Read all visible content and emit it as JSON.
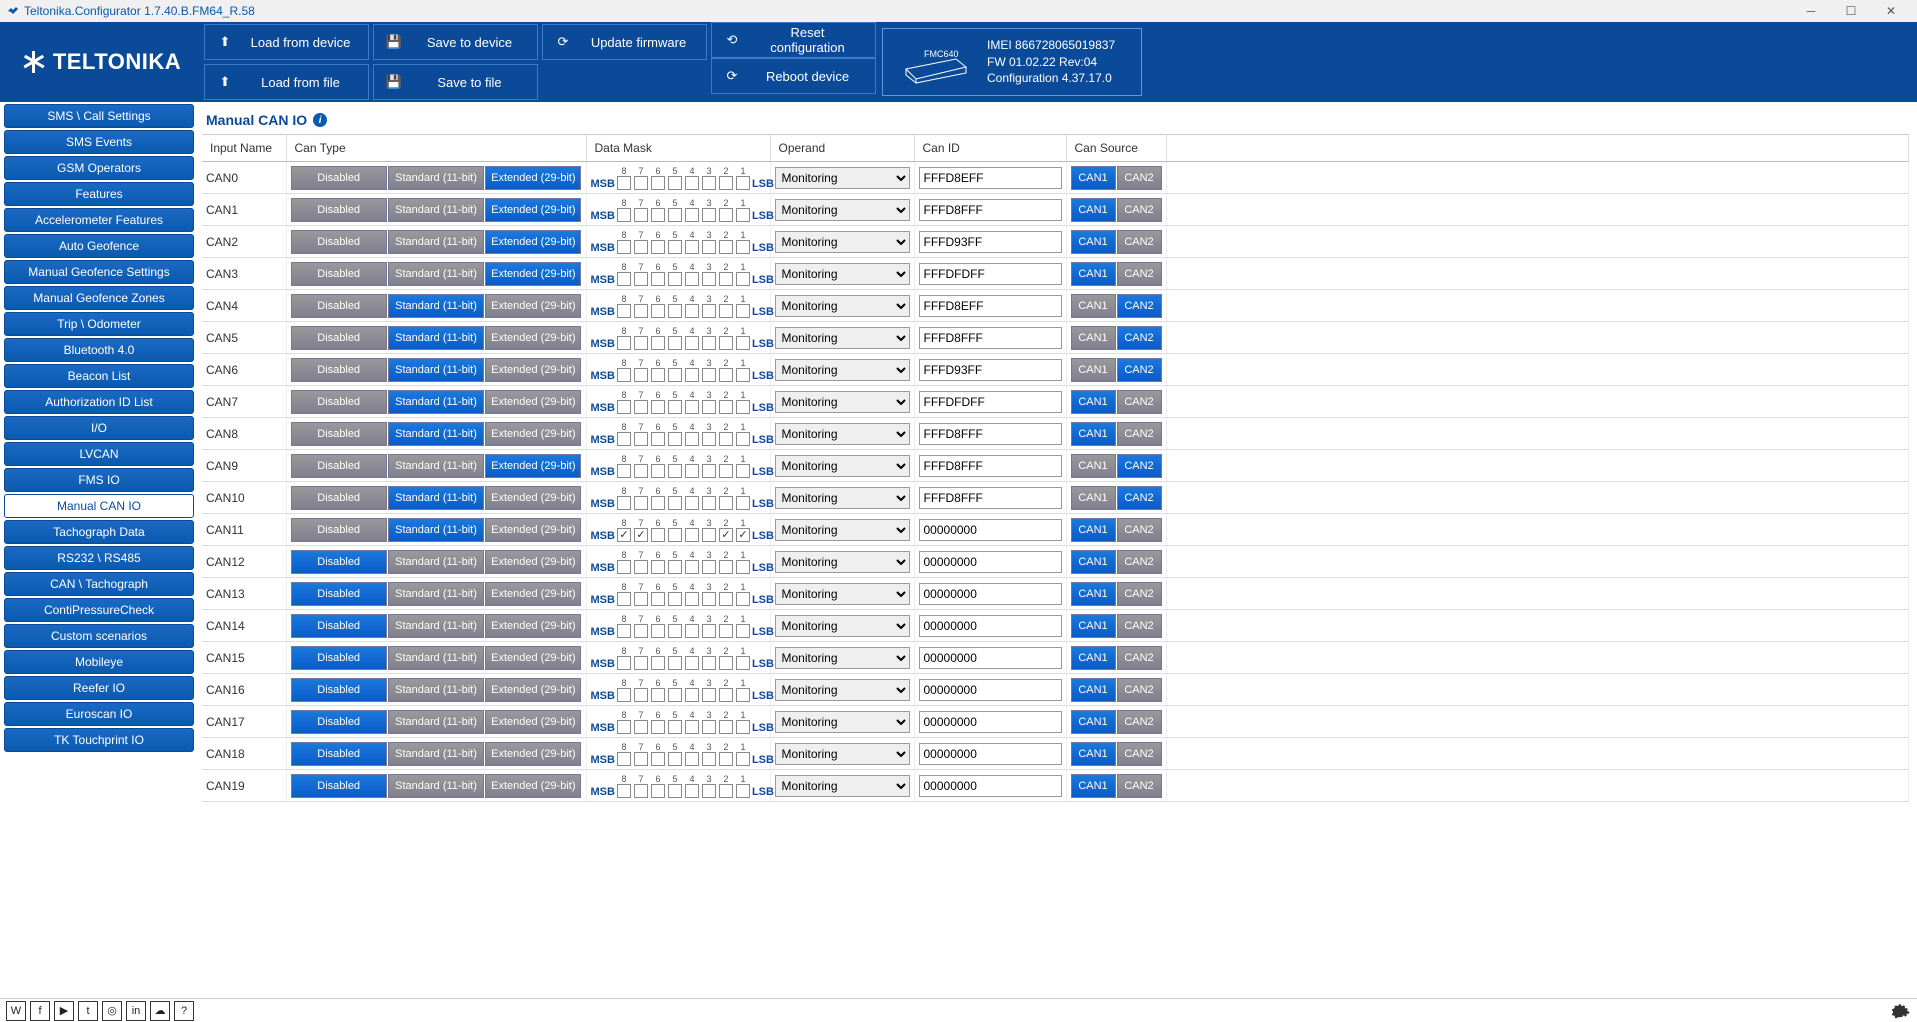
{
  "window": {
    "title": "Teltonika.Configurator 1.7.40.B.FM64_R.58"
  },
  "logo": "TELTONIKA",
  "toolbar": {
    "load_device": "Load from device",
    "save_device": "Save to device",
    "update_fw": "Update firmware",
    "reset_cfg": "Reset configuration",
    "load_file": "Load from file",
    "save_file": "Save to file",
    "reboot": "Reboot device"
  },
  "device": {
    "model": "FMC640",
    "imei_label": "IMEI",
    "imei": "866728065019837",
    "fw_label": "FW",
    "fw": "01.02.22 Rev:04",
    "cfg_label": "Configuration",
    "cfg": "4.37.17.0"
  },
  "sidebar": [
    "SMS \\ Call Settings",
    "SMS Events",
    "GSM Operators",
    "Features",
    "Accelerometer Features",
    "Auto Geofence",
    "Manual Geofence Settings",
    "Manual Geofence Zones",
    "Trip \\ Odometer",
    "Bluetooth 4.0",
    "Beacon List",
    "Authorization ID List",
    "I/O",
    "LVCAN",
    "FMS IO",
    "Manual CAN IO",
    "Tachograph Data",
    "RS232 \\ RS485",
    "CAN \\ Tachograph",
    "ContiPressureCheck",
    "Custom scenarios",
    "Mobileye",
    "Reefer IO",
    "Euroscan IO",
    "TK Touchprint IO"
  ],
  "sidebar_active": 15,
  "section_title": "Manual CAN IO",
  "columns": {
    "name": "Input Name",
    "type": "Can Type",
    "mask": "Data Mask",
    "operand": "Operand",
    "canid": "Can ID",
    "source": "Can Source"
  },
  "seg_labels": {
    "disabled": "Disabled",
    "std": "Standard (11-bit)",
    "ext": "Extended (29-bit)"
  },
  "mask_labels": {
    "msb": "MSB",
    "lsb": "LSB"
  },
  "src_labels": {
    "can1": "CAN1",
    "can2": "CAN2"
  },
  "operand_options": [
    "Monitoring"
  ],
  "bit_numbers": [
    "8",
    "7",
    "6",
    "5",
    "4",
    "3",
    "2",
    "1"
  ],
  "rows": [
    {
      "name": "CAN0",
      "type": "ext",
      "mask": [
        0,
        0,
        0,
        0,
        0,
        0,
        0,
        0
      ],
      "operand": "Monitoring",
      "canid": "FFFD8EFF",
      "src": "can1"
    },
    {
      "name": "CAN1",
      "type": "ext",
      "mask": [
        0,
        0,
        0,
        0,
        0,
        0,
        0,
        0
      ],
      "operand": "Monitoring",
      "canid": "FFFD8FFF",
      "src": "can1"
    },
    {
      "name": "CAN2",
      "type": "ext",
      "mask": [
        0,
        0,
        0,
        0,
        0,
        0,
        0,
        0
      ],
      "operand": "Monitoring",
      "canid": "FFFD93FF",
      "src": "can1"
    },
    {
      "name": "CAN3",
      "type": "ext",
      "mask": [
        0,
        0,
        0,
        0,
        0,
        0,
        0,
        0
      ],
      "operand": "Monitoring",
      "canid": "FFFDFDFF",
      "src": "can1"
    },
    {
      "name": "CAN4",
      "type": "std",
      "mask": [
        0,
        0,
        0,
        0,
        0,
        0,
        0,
        0
      ],
      "operand": "Monitoring",
      "canid": "FFFD8EFF",
      "src": "can2"
    },
    {
      "name": "CAN5",
      "type": "std",
      "mask": [
        0,
        0,
        0,
        0,
        0,
        0,
        0,
        0
      ],
      "operand": "Monitoring",
      "canid": "FFFD8FFF",
      "src": "can2"
    },
    {
      "name": "CAN6",
      "type": "std",
      "mask": [
        0,
        0,
        0,
        0,
        0,
        0,
        0,
        0
      ],
      "operand": "Monitoring",
      "canid": "FFFD93FF",
      "src": "can2"
    },
    {
      "name": "CAN7",
      "type": "std",
      "mask": [
        0,
        0,
        0,
        0,
        0,
        0,
        0,
        0
      ],
      "operand": "Monitoring",
      "canid": "FFFDFDFF",
      "src": "can1"
    },
    {
      "name": "CAN8",
      "type": "std",
      "mask": [
        0,
        0,
        0,
        0,
        0,
        0,
        0,
        0
      ],
      "operand": "Monitoring",
      "canid": "FFFD8FFF",
      "src": "can1"
    },
    {
      "name": "CAN9",
      "type": "ext",
      "mask": [
        0,
        0,
        0,
        0,
        0,
        0,
        0,
        0
      ],
      "operand": "Monitoring",
      "canid": "FFFD8FFF",
      "src": "can2"
    },
    {
      "name": "CAN10",
      "type": "std",
      "mask": [
        0,
        0,
        0,
        0,
        0,
        0,
        0,
        0
      ],
      "operand": "Monitoring",
      "canid": "FFFD8FFF",
      "src": "can2"
    },
    {
      "name": "CAN11",
      "type": "std",
      "mask": [
        1,
        1,
        0,
        0,
        0,
        0,
        1,
        1
      ],
      "operand": "Monitoring",
      "canid": "00000000",
      "src": "can1"
    },
    {
      "name": "CAN12",
      "type": "disabled",
      "mask": [
        0,
        0,
        0,
        0,
        0,
        0,
        0,
        0
      ],
      "operand": "Monitoring",
      "canid": "00000000",
      "src": "can1"
    },
    {
      "name": "CAN13",
      "type": "disabled",
      "mask": [
        0,
        0,
        0,
        0,
        0,
        0,
        0,
        0
      ],
      "operand": "Monitoring",
      "canid": "00000000",
      "src": "can1"
    },
    {
      "name": "CAN14",
      "type": "disabled",
      "mask": [
        0,
        0,
        0,
        0,
        0,
        0,
        0,
        0
      ],
      "operand": "Monitoring",
      "canid": "00000000",
      "src": "can1"
    },
    {
      "name": "CAN15",
      "type": "disabled",
      "mask": [
        0,
        0,
        0,
        0,
        0,
        0,
        0,
        0
      ],
      "operand": "Monitoring",
      "canid": "00000000",
      "src": "can1"
    },
    {
      "name": "CAN16",
      "type": "disabled",
      "mask": [
        0,
        0,
        0,
        0,
        0,
        0,
        0,
        0
      ],
      "operand": "Monitoring",
      "canid": "00000000",
      "src": "can1"
    },
    {
      "name": "CAN17",
      "type": "disabled",
      "mask": [
        0,
        0,
        0,
        0,
        0,
        0,
        0,
        0
      ],
      "operand": "Monitoring",
      "canid": "00000000",
      "src": "can1"
    },
    {
      "name": "CAN18",
      "type": "disabled",
      "mask": [
        0,
        0,
        0,
        0,
        0,
        0,
        0,
        0
      ],
      "operand": "Monitoring",
      "canid": "00000000",
      "src": "can1"
    },
    {
      "name": "CAN19",
      "type": "disabled",
      "mask": [
        0,
        0,
        0,
        0,
        0,
        0,
        0,
        0
      ],
      "operand": "Monitoring",
      "canid": "00000000",
      "src": "can1"
    }
  ],
  "social": [
    "wiki",
    "facebook",
    "youtube",
    "twitter",
    "instagram",
    "linkedin",
    "support",
    "help"
  ]
}
